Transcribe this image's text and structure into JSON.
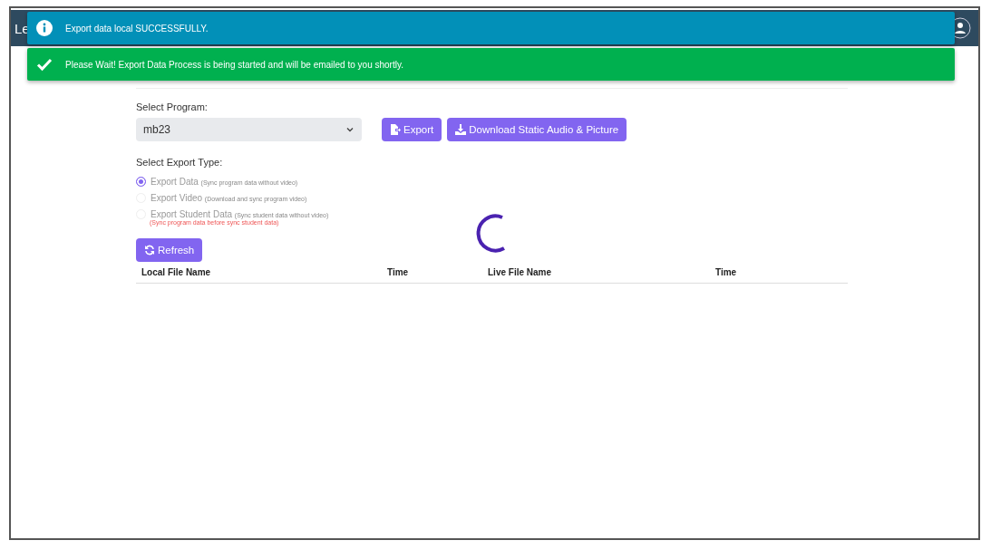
{
  "navbar": {
    "brand": "Le"
  },
  "toasts": [
    {
      "kind": "info",
      "message": "Export data local SUCCESSFULLY."
    },
    {
      "kind": "success",
      "message": "Please Wait! Export Data Process is being started and will be emailed to you shortly."
    }
  ],
  "program": {
    "label": "Select Program:",
    "value": "mb23"
  },
  "buttons": [
    {
      "kind": "export",
      "label": "Export"
    },
    {
      "kind": "download",
      "label": "Download Static Audio & Picture"
    }
  ],
  "export_type": {
    "label": "Select Export Type:",
    "options": [
      {
        "label": "Export Data",
        "hint": "(Sync program data without video)",
        "selected": true
      },
      {
        "label": "Export Video",
        "hint": "(Download and sync program video)",
        "selected": false
      },
      {
        "label": "Export Student Data",
        "hint": "(Sync student data without video)",
        "selected": false,
        "warning": "(Sync program data before sync student data)"
      }
    ]
  },
  "refresh_button": "Refresh",
  "table": {
    "columns": [
      "Local File Name",
      "Time",
      "Live File Name",
      "Time"
    ]
  }
}
